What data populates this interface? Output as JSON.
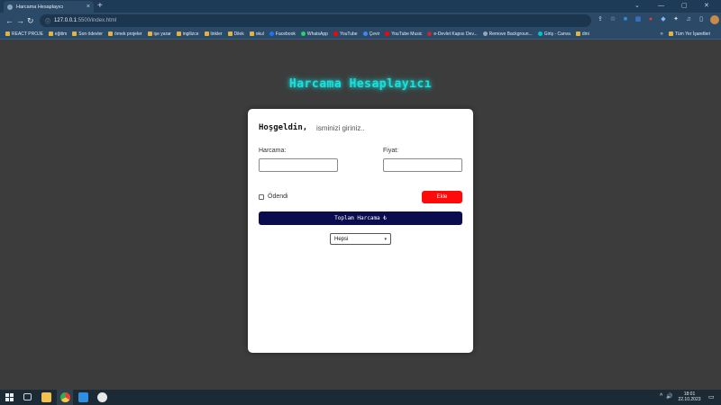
{
  "browser": {
    "tab_title": "Harcama Hesaplayıcı",
    "tab_close": "×",
    "new_tab": "+",
    "window_controls": {
      "chevron": "⌄",
      "minimize": "—",
      "maximize": "▢",
      "close": "✕"
    },
    "nav": {
      "back": "←",
      "forward": "→",
      "reload": "↻"
    },
    "omni_info": "ⓘ",
    "url_host": "127.0.0.1",
    "url_path": ":5500/index.html",
    "bookmarks": [
      {
        "label": "REACT PROJE",
        "icon": "folder-icon"
      },
      {
        "label": "eğitim",
        "icon": "folder-icon"
      },
      {
        "label": "Son ödevler",
        "icon": "folder-icon"
      },
      {
        "label": "örnek projeler",
        "icon": "folder-icon"
      },
      {
        "label": "işe yarar",
        "icon": "folder-icon"
      },
      {
        "label": "ingilizce",
        "icon": "folder-icon"
      },
      {
        "label": "linkler",
        "icon": "folder-icon"
      },
      {
        "label": "Dilek",
        "icon": "folder-icon"
      },
      {
        "label": "okul",
        "icon": "folder-icon"
      },
      {
        "label": "Facebook",
        "icon": "facebook-icon",
        "color": "#1877f2"
      },
      {
        "label": "WhatsApp",
        "icon": "whatsapp-icon",
        "color": "#25d366"
      },
      {
        "label": "YouTube",
        "icon": "youtube-icon",
        "color": "#ff0000"
      },
      {
        "label": "Çevir",
        "icon": "translate-icon",
        "color": "#4285f4"
      },
      {
        "label": "YouTube Music",
        "icon": "youtube-music-icon",
        "color": "#ff0000"
      },
      {
        "label": "e-Devlet Kapısı Dev...",
        "icon": "edevlet-icon",
        "color": "#c62828"
      },
      {
        "label": "Remove Backgroun...",
        "icon": "remove-bg-icon",
        "color": "#9aa5ae"
      },
      {
        "label": "Giriş - Canva",
        "icon": "canva-icon",
        "color": "#00c4cc"
      },
      {
        "label": "dini",
        "icon": "folder-icon"
      }
    ],
    "bookmarks_more": "»",
    "all_bookmarks": "Tüm Yer İşaretleri"
  },
  "app": {
    "title": "Harcama Hesaplayıcı",
    "welcome": "Hoşgeldin,",
    "name_placeholder": "isminizi giriniz..",
    "expense_label": "Harcama:",
    "price_label": "Fiyat:",
    "paid_label": "Ödendi",
    "add_button": "Ekle",
    "total_label": "Toplam Harcama ₺",
    "filter": {
      "selected": "Hepsi",
      "caret": "▾"
    }
  },
  "taskbar": {
    "tray_chevron": "^",
    "tray_volume": "🔊",
    "time": "18:01",
    "date": "22.10.2023",
    "notification": "▭"
  },
  "colors": {
    "title_glow": "#19e0dc",
    "add_button": "#ff0a0a",
    "total_button": "#0b0b4f",
    "page_bg": "#3c3c3c"
  }
}
